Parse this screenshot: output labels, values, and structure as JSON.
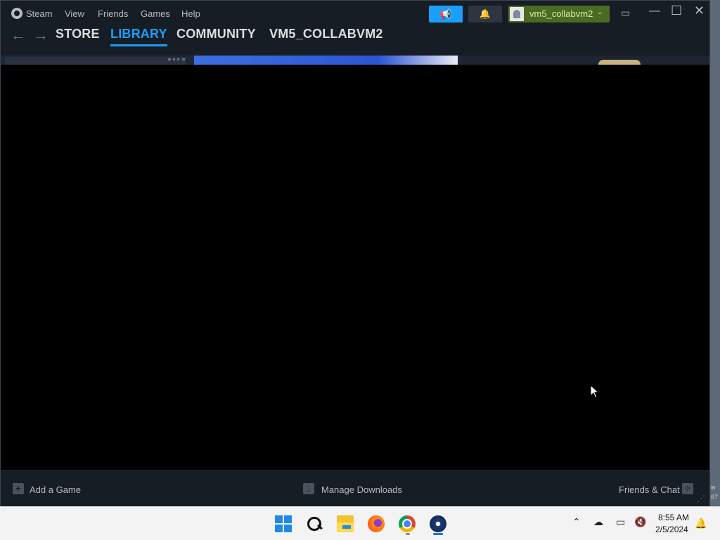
{
  "menubar": {
    "app_name": "Steam",
    "items": [
      "View",
      "Friends",
      "Games",
      "Help"
    ],
    "account_name": "vm5_collabvm2",
    "caret": "⌄"
  },
  "nav": {
    "back": "←",
    "forward": "→",
    "links": [
      "STORE",
      "LIBRARY",
      "COMMUNITY",
      "VM5_COLLABVM2"
    ],
    "active": "LIBRARY"
  },
  "bottombar": {
    "add_game": "Add a Game",
    "manage_downloads": "Manage Downloads",
    "friends_chat": "Friends & Chat"
  },
  "desktop": {
    "side_text_1": "w",
    "side_text_2": "67"
  },
  "taskbar": {
    "apps": [
      "start-icon",
      "search-icon",
      "file-explorer-icon",
      "firefox-icon",
      "chrome-icon",
      "steam-icon"
    ],
    "time": "8:55 AM",
    "date": "2/5/2024"
  },
  "colors": {
    "accent": "#1a9fff",
    "account_bg": "#4c6b22",
    "window_bg": "#171d25"
  }
}
